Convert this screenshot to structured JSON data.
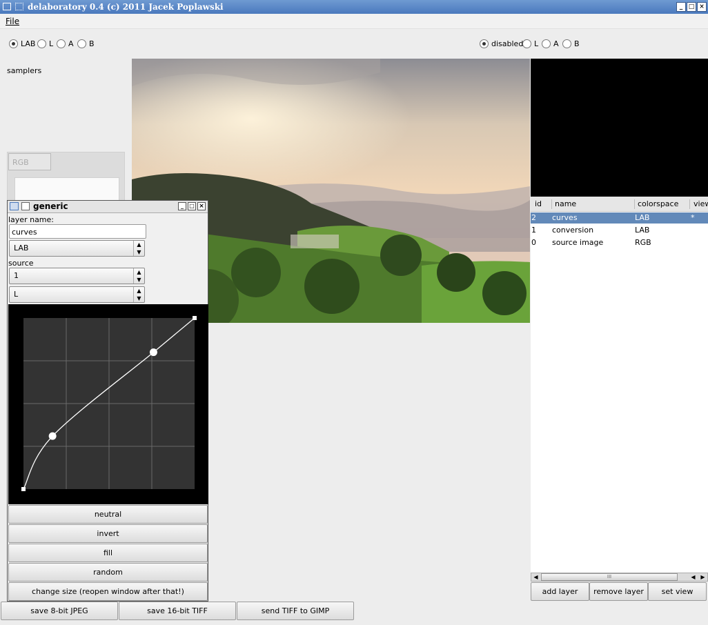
{
  "window": {
    "title": "delaboratory 0.4 (c) 2011 Jacek Poplawski",
    "minimize": "_",
    "maximize": "□",
    "close": "×"
  },
  "menu": {
    "file": "File"
  },
  "left_radios": [
    {
      "label": "LAB",
      "checked": true
    },
    {
      "label": "L",
      "checked": false
    },
    {
      "label": "A",
      "checked": false
    },
    {
      "label": "B",
      "checked": false
    }
  ],
  "right_radios": [
    {
      "label": "disabled",
      "checked": true
    },
    {
      "label": "L",
      "checked": false
    },
    {
      "label": "A",
      "checked": false
    },
    {
      "label": "B",
      "checked": false
    }
  ],
  "samplers": {
    "label": "samplers",
    "combo_value": "RGB"
  },
  "layers_table": {
    "columns": [
      "id",
      "name",
      "colorspace",
      "view"
    ],
    "rows": [
      {
        "id": "2",
        "name": "curves",
        "colorspace": "LAB",
        "view": "*",
        "selected": true
      },
      {
        "id": "1",
        "name": "conversion",
        "colorspace": "LAB",
        "view": "",
        "selected": false
      },
      {
        "id": "0",
        "name": "source image",
        "colorspace": "RGB",
        "view": "",
        "selected": false
      }
    ],
    "scroll_grip": "III"
  },
  "layer_buttons": {
    "add": "add layer",
    "remove": "remove layer",
    "set_view": "set view"
  },
  "bottom_buttons": {
    "save_jpeg": "save 8-bit JPEG",
    "save_tiff": "save 16-bit TIFF",
    "send_gimp": "send TIFF to GIMP"
  },
  "generic_window": {
    "title": "generic",
    "layer_name_label": "layer name:",
    "layer_name_value": "curves",
    "colorspace": "LAB",
    "source_label": "source",
    "source_value": "1",
    "channel_value": "L",
    "curve_points": [
      [
        0,
        0
      ],
      [
        0.17,
        0.31
      ],
      [
        0.76,
        0.8
      ],
      [
        1,
        1
      ]
    ],
    "buttons": {
      "neutral": "neutral",
      "invert": "invert",
      "fill": "fill",
      "random": "random",
      "change_size": "change size (reopen window after that!)"
    }
  },
  "colors": {
    "titlebar": "#4a79bd",
    "selection": "#6289b9",
    "curve_bg": "#333333"
  }
}
